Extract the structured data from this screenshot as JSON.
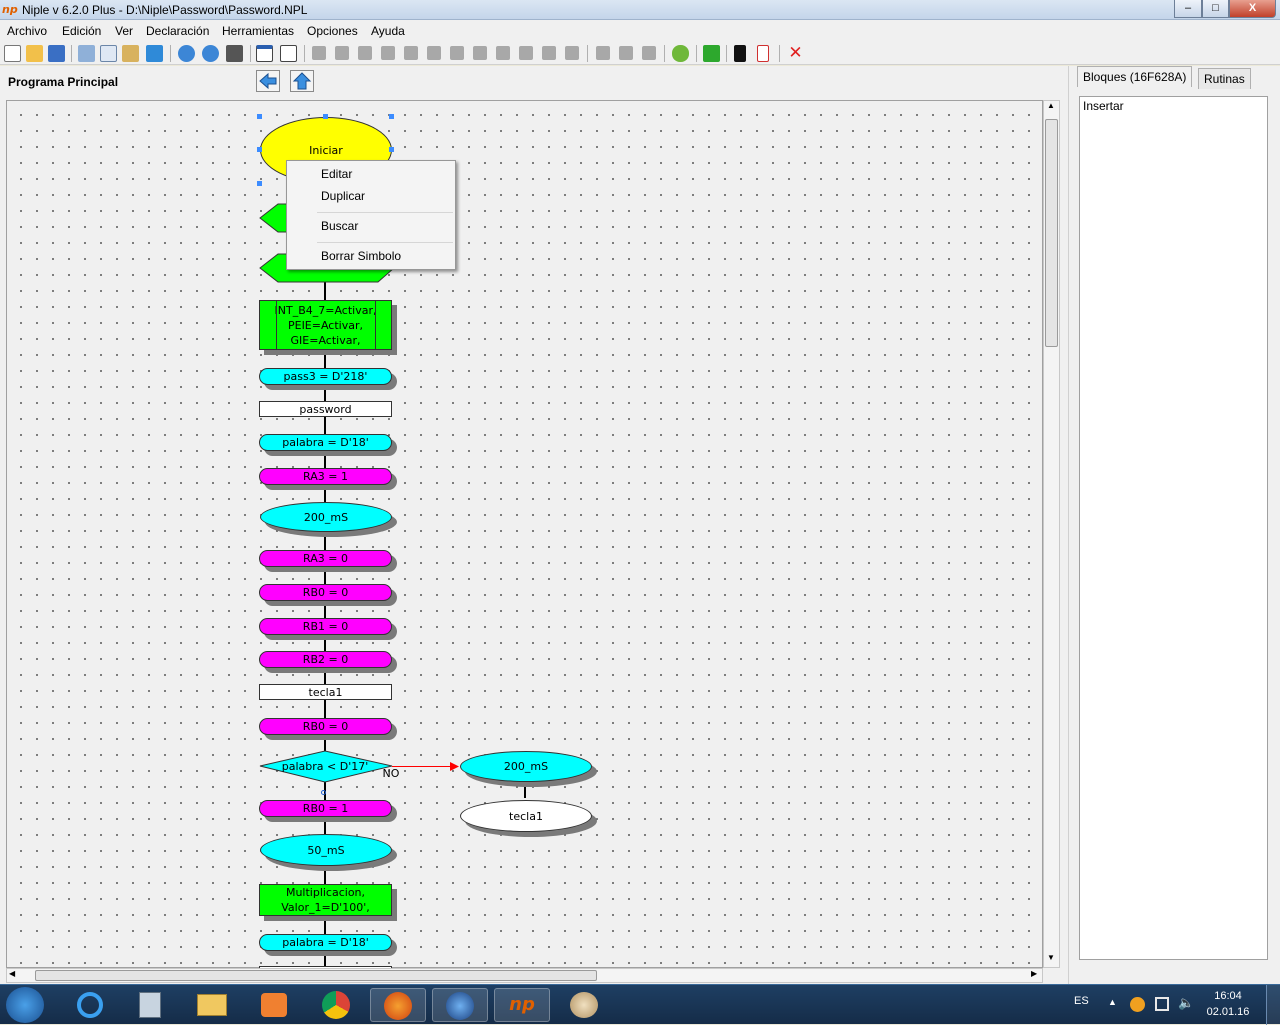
{
  "window": {
    "title": "Niple v 6.2.0 Plus - D:\\Niple\\Password\\Password.NPL",
    "icon_text": "np",
    "min": "–",
    "max": "□",
    "close": "X"
  },
  "menu": [
    "Archivo",
    "Edición",
    "Ver",
    "Declaración",
    "Herramientas",
    "Opciones",
    "Ayuda"
  ],
  "left_panel": {
    "title": "Programa Principal"
  },
  "right_panel": {
    "tabs": [
      "Bloques (16F628A)",
      "Rutinas"
    ],
    "list_items": [
      "Insertar"
    ]
  },
  "flow": {
    "start": "Iniciar",
    "int_block": [
      "INT_B4_7=Activar,",
      "PEIE=Activar,",
      "GIE=Activar,"
    ],
    "pass3": "pass3 = D'218'",
    "password": "password",
    "palabra1": "palabra = D'18'",
    "ra3_on": "RA3 = 1",
    "delay1": "200_mS",
    "ra3_off": "RA3 = 0",
    "rb0_off": "RB0 = 0",
    "rb1_off": "RB1 = 0",
    "rb2_off": "RB2 = 0",
    "tecla1": "tecla1",
    "rb0_off2": "RB0 = 0",
    "decision": "palabra < D'17'",
    "decision_no": "NO",
    "branch_delay": "200_mS",
    "branch_tecla": "tecla1",
    "rb0_on": "RB0 = 1",
    "delay2": "50_mS",
    "mult": [
      "Multiplicacion,",
      "Valor_1=D'100',"
    ],
    "palabra2": "palabra = D'18'"
  },
  "context_menu": [
    "Editar",
    "Duplicar",
    "Buscar",
    "Borrar Simbolo"
  ],
  "taskbar": {
    "lang": "ES",
    "time": "16:04",
    "date": "02.01.16"
  },
  "colors": {
    "cyan": "#00ffff",
    "magenta": "#ff00ff",
    "green": "#00ff00",
    "yellow": "#ffff00",
    "decision_line": "#ff0000"
  }
}
